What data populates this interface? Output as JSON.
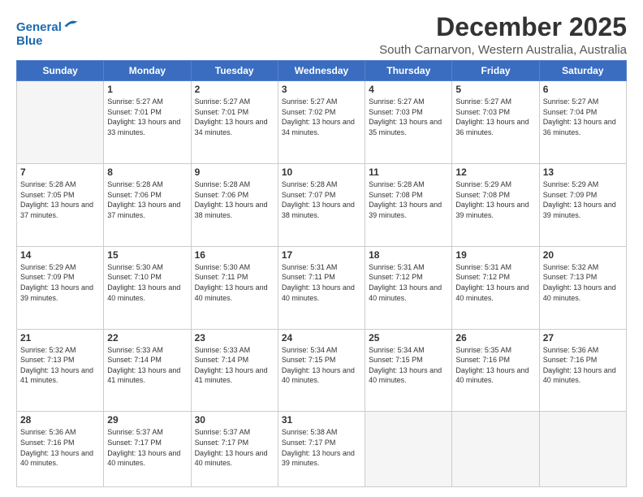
{
  "header": {
    "logo_line1": "General",
    "logo_line2": "Blue",
    "title": "December 2025",
    "subtitle": "South Carnarvon, Western Australia, Australia"
  },
  "columns": [
    "Sunday",
    "Monday",
    "Tuesday",
    "Wednesday",
    "Thursday",
    "Friday",
    "Saturday"
  ],
  "weeks": [
    [
      {
        "day": "",
        "empty": true
      },
      {
        "day": "1",
        "sunrise": "5:27 AM",
        "sunset": "7:01 PM",
        "daylight": "13 hours and 33 minutes."
      },
      {
        "day": "2",
        "sunrise": "5:27 AM",
        "sunset": "7:01 PM",
        "daylight": "13 hours and 34 minutes."
      },
      {
        "day": "3",
        "sunrise": "5:27 AM",
        "sunset": "7:02 PM",
        "daylight": "13 hours and 34 minutes."
      },
      {
        "day": "4",
        "sunrise": "5:27 AM",
        "sunset": "7:03 PM",
        "daylight": "13 hours and 35 minutes."
      },
      {
        "day": "5",
        "sunrise": "5:27 AM",
        "sunset": "7:03 PM",
        "daylight": "13 hours and 36 minutes."
      },
      {
        "day": "6",
        "sunrise": "5:27 AM",
        "sunset": "7:04 PM",
        "daylight": "13 hours and 36 minutes."
      }
    ],
    [
      {
        "day": "7",
        "sunrise": "5:28 AM",
        "sunset": "7:05 PM",
        "daylight": "13 hours and 37 minutes."
      },
      {
        "day": "8",
        "sunrise": "5:28 AM",
        "sunset": "7:06 PM",
        "daylight": "13 hours and 37 minutes."
      },
      {
        "day": "9",
        "sunrise": "5:28 AM",
        "sunset": "7:06 PM",
        "daylight": "13 hours and 38 minutes."
      },
      {
        "day": "10",
        "sunrise": "5:28 AM",
        "sunset": "7:07 PM",
        "daylight": "13 hours and 38 minutes."
      },
      {
        "day": "11",
        "sunrise": "5:28 AM",
        "sunset": "7:08 PM",
        "daylight": "13 hours and 39 minutes."
      },
      {
        "day": "12",
        "sunrise": "5:29 AM",
        "sunset": "7:08 PM",
        "daylight": "13 hours and 39 minutes."
      },
      {
        "day": "13",
        "sunrise": "5:29 AM",
        "sunset": "7:09 PM",
        "daylight": "13 hours and 39 minutes."
      }
    ],
    [
      {
        "day": "14",
        "sunrise": "5:29 AM",
        "sunset": "7:09 PM",
        "daylight": "13 hours and 39 minutes."
      },
      {
        "day": "15",
        "sunrise": "5:30 AM",
        "sunset": "7:10 PM",
        "daylight": "13 hours and 40 minutes."
      },
      {
        "day": "16",
        "sunrise": "5:30 AM",
        "sunset": "7:11 PM",
        "daylight": "13 hours and 40 minutes."
      },
      {
        "day": "17",
        "sunrise": "5:31 AM",
        "sunset": "7:11 PM",
        "daylight": "13 hours and 40 minutes."
      },
      {
        "day": "18",
        "sunrise": "5:31 AM",
        "sunset": "7:12 PM",
        "daylight": "13 hours and 40 minutes."
      },
      {
        "day": "19",
        "sunrise": "5:31 AM",
        "sunset": "7:12 PM",
        "daylight": "13 hours and 40 minutes."
      },
      {
        "day": "20",
        "sunrise": "5:32 AM",
        "sunset": "7:13 PM",
        "daylight": "13 hours and 40 minutes."
      }
    ],
    [
      {
        "day": "21",
        "sunrise": "5:32 AM",
        "sunset": "7:13 PM",
        "daylight": "13 hours and 41 minutes."
      },
      {
        "day": "22",
        "sunrise": "5:33 AM",
        "sunset": "7:14 PM",
        "daylight": "13 hours and 41 minutes."
      },
      {
        "day": "23",
        "sunrise": "5:33 AM",
        "sunset": "7:14 PM",
        "daylight": "13 hours and 41 minutes."
      },
      {
        "day": "24",
        "sunrise": "5:34 AM",
        "sunset": "7:15 PM",
        "daylight": "13 hours and 40 minutes."
      },
      {
        "day": "25",
        "sunrise": "5:34 AM",
        "sunset": "7:15 PM",
        "daylight": "13 hours and 40 minutes."
      },
      {
        "day": "26",
        "sunrise": "5:35 AM",
        "sunset": "7:16 PM",
        "daylight": "13 hours and 40 minutes."
      },
      {
        "day": "27",
        "sunrise": "5:36 AM",
        "sunset": "7:16 PM",
        "daylight": "13 hours and 40 minutes."
      }
    ],
    [
      {
        "day": "28",
        "sunrise": "5:36 AM",
        "sunset": "7:16 PM",
        "daylight": "13 hours and 40 minutes."
      },
      {
        "day": "29",
        "sunrise": "5:37 AM",
        "sunset": "7:17 PM",
        "daylight": "13 hours and 40 minutes."
      },
      {
        "day": "30",
        "sunrise": "5:37 AM",
        "sunset": "7:17 PM",
        "daylight": "13 hours and 40 minutes."
      },
      {
        "day": "31",
        "sunrise": "5:38 AM",
        "sunset": "7:17 PM",
        "daylight": "13 hours and 39 minutes."
      },
      {
        "day": "",
        "empty": true
      },
      {
        "day": "",
        "empty": true
      },
      {
        "day": "",
        "empty": true
      }
    ]
  ]
}
